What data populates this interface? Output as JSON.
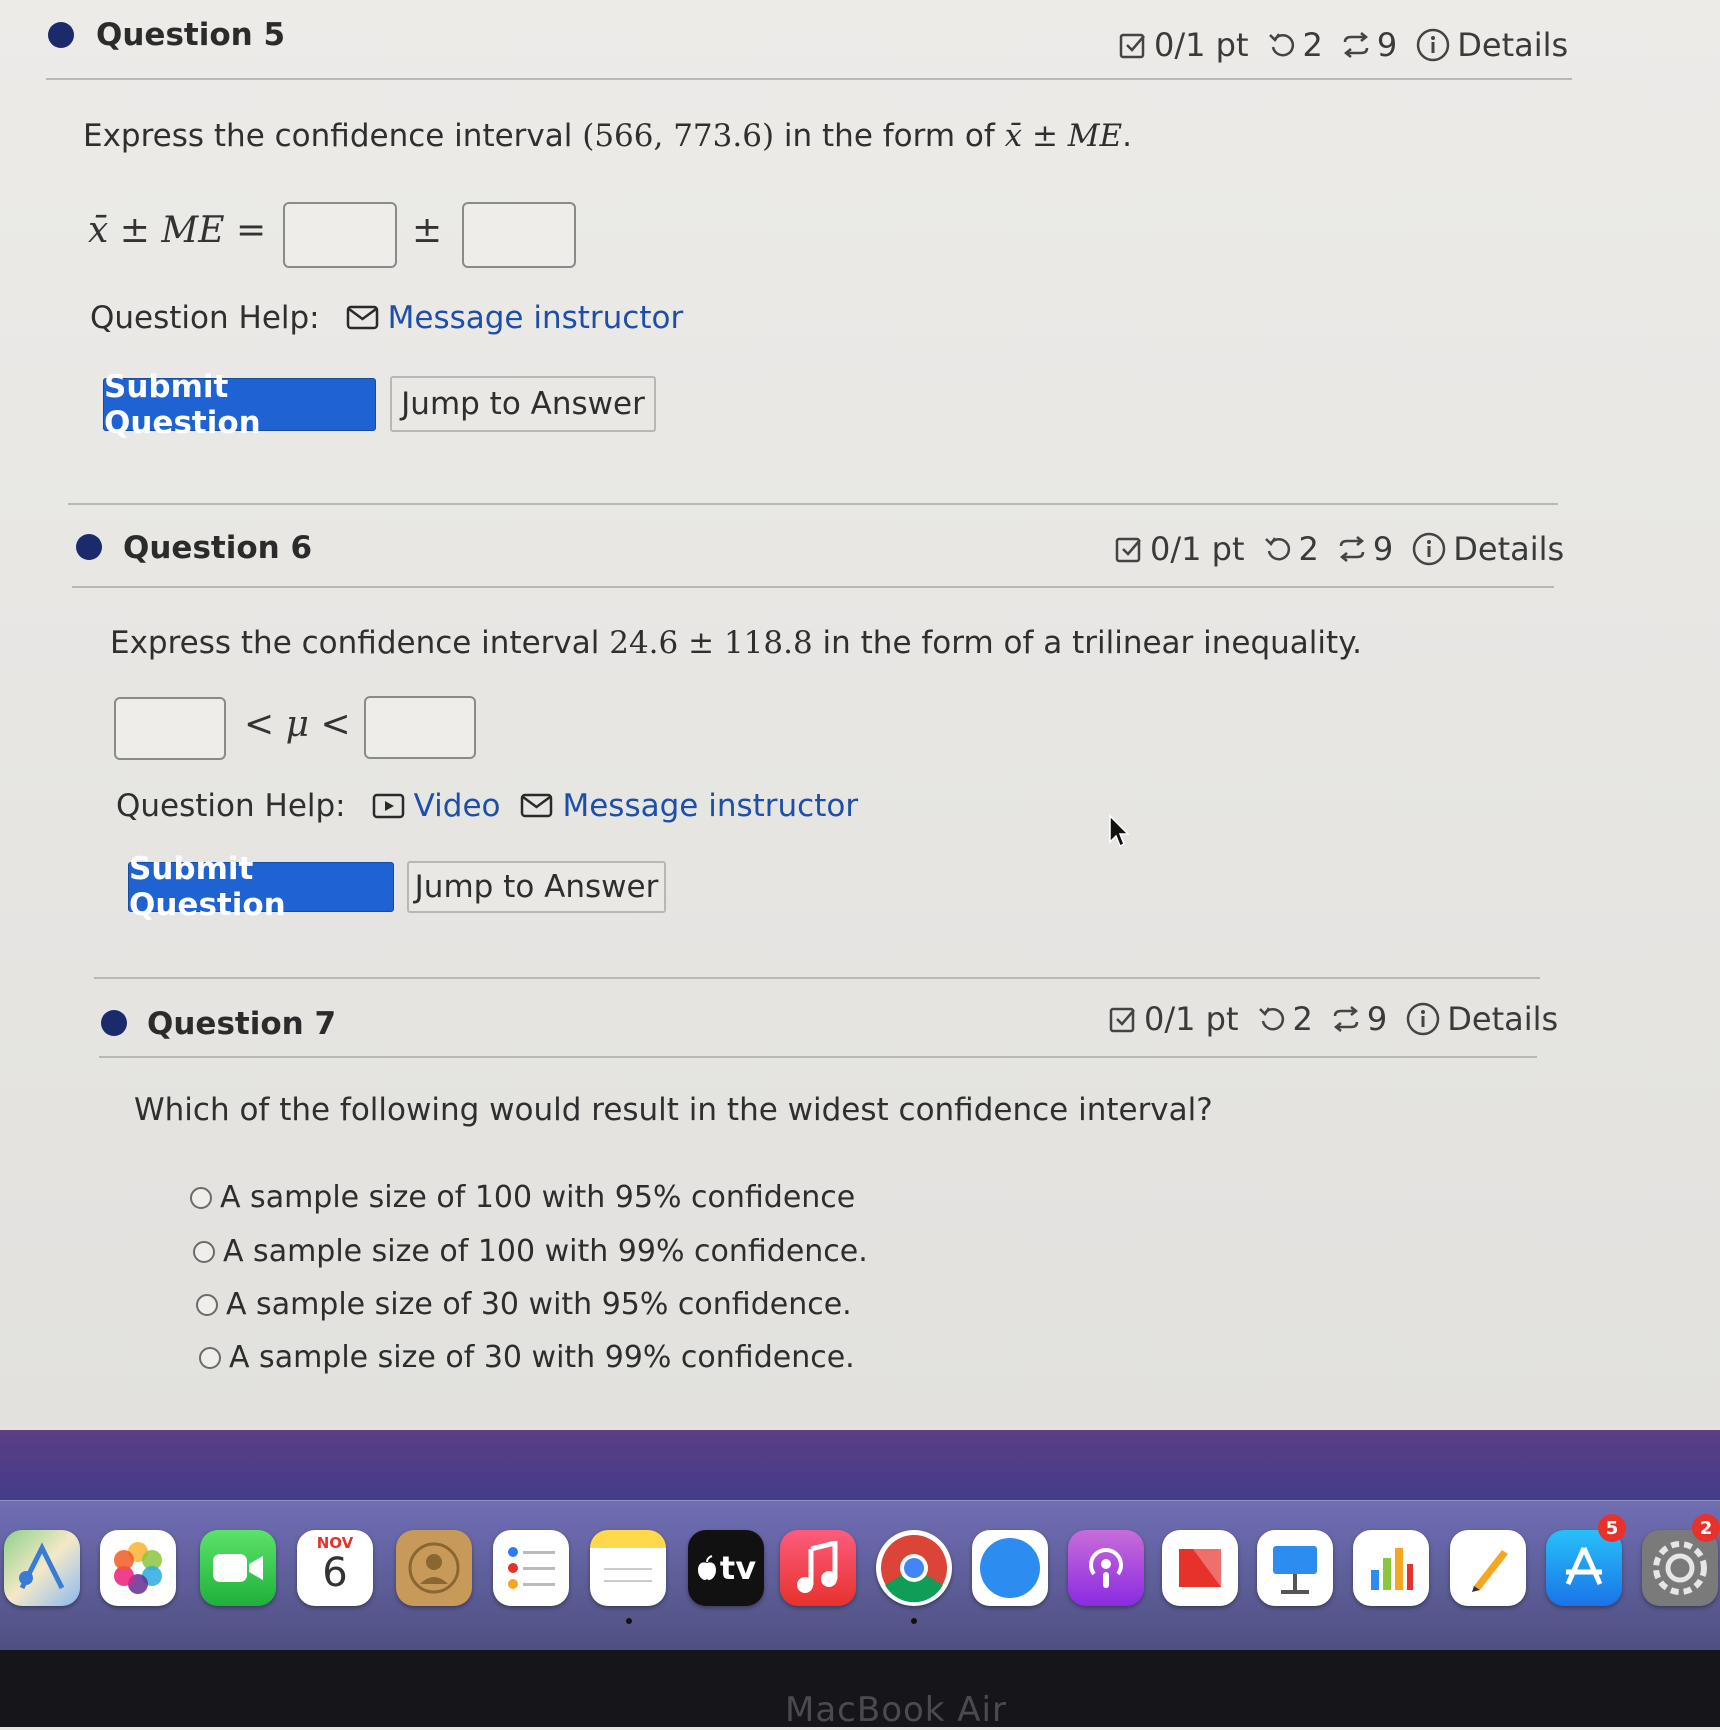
{
  "questions": [
    {
      "title": "Question 5",
      "points": "0/1 pt",
      "retries": "2",
      "attempts": "9",
      "details": "Details",
      "prompt_prefix": "Express the confidence interval ",
      "prompt_math": "(566, 773.6)",
      "prompt_mid": " in the form of ",
      "prompt_math2": "x̄ ± ME",
      "prompt_suffix": ".",
      "expr_left": "x̄ ± ME =",
      "expr_mid": "±",
      "help_label": "Question Help:",
      "help_message": "Message instructor",
      "submit": "Submit Question",
      "jump": "Jump to Answer"
    },
    {
      "title": "Question 6",
      "points": "0/1 pt",
      "retries": "2",
      "attempts": "9",
      "details": "Details",
      "prompt_prefix": "Express the confidence interval ",
      "prompt_math": "24.6 ± 118.8",
      "prompt_suffix": " in the form of a trilinear inequality.",
      "expr_mid": "< μ <",
      "help_label": "Question Help:",
      "help_video": "Video",
      "help_message": "Message instructor",
      "submit": "Submit Question",
      "jump": "Jump to Answer"
    },
    {
      "title": "Question 7",
      "points": "0/1 pt",
      "retries": "2",
      "attempts": "9",
      "details": "Details",
      "prompt": "Which of the following would result in the widest confidence interval?",
      "options": [
        "A sample size of 100 with 95% confidence",
        "A sample size of 100 with 99% confidence.",
        "A sample size of 30 with 95% confidence.",
        "A sample size of 30 with 99% confidence."
      ]
    }
  ],
  "dock": {
    "calendar_month": "NOV",
    "calendar_day": "6",
    "tv_label": "tv",
    "app_store_badge": "5",
    "settings_badge": "2"
  },
  "device_label": "MacBook Air",
  "colors": {
    "primary_button": "#1f63d3",
    "link": "#1d4fa8",
    "bullet": "#1b2a6b"
  }
}
